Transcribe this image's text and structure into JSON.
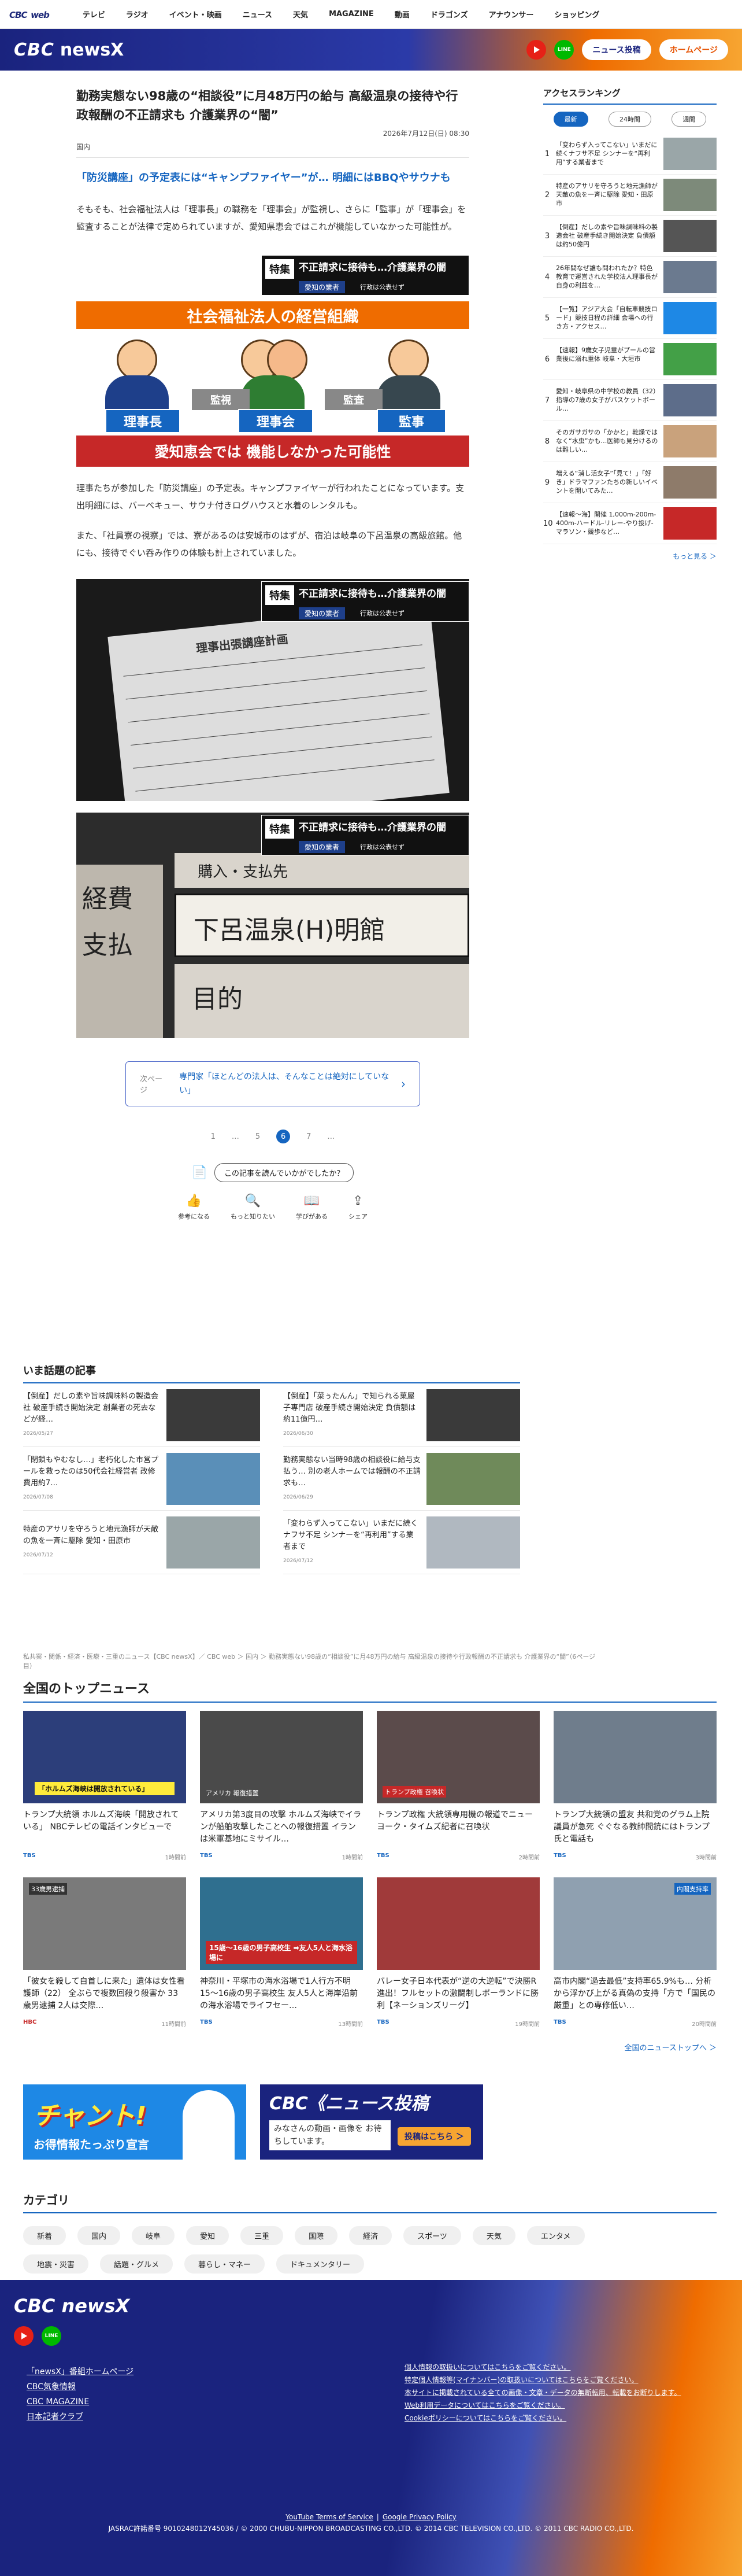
{
  "topnav": {
    "logo": "CBC",
    "logo_sub": "web",
    "items": [
      "テレビ",
      "ラジオ",
      "イベント・映画",
      "ニュース",
      "天気",
      "MAGAZINE",
      "動画",
      "ドラゴンズ",
      "アナウンサー",
      "ショッピング"
    ]
  },
  "banner": {
    "brand": "CBC",
    "brand2": "newsX",
    "post_btn": "ニュース投稿",
    "home_btn": "ホームページ"
  },
  "article": {
    "title": "勤務実態ない98歳の“相談役”に月48万円の給与 高級温泉の接待や行政報酬の不正請求も 介護業界の“闇”",
    "date": "2026年7月12日(日) 08:30",
    "category": "国内",
    "lead": "「防災講座」の予定表には“キャンプファイヤー”が… 明細にはBBQやサウナも",
    "p1": "そもそも、社会福祉法人は「理事長」の職務を「理事会」が監視し、さらに「監事」が「理事会」を監査することが法律で定められていますが、愛知県恵会ではこれが機能していなかった可能性が。",
    "p2": "理事たちが参加した「防災講座」の予定表。キャンプファイヤーが行われたことになっています。支出明細には、バーベキュー、サウナ付きログハウスと水着のレンタルも。",
    "p3": "また、「社員寮の視察」では、寮があるのは安城市のはずが、宿泊は岐阜の下呂温泉の高級旅館。他にも、接待でぐい呑み作りの体験も計上されていました。",
    "badge": {
      "tokushu": "特集",
      "headline": "不正請求に接待も…介護業界の闇",
      "tag": "愛知の業者",
      "sub": "行政は公表せず"
    },
    "fig1": {
      "heading": "社会福祉法人の経営組織",
      "role1": "理事長",
      "role2": "理事会",
      "role3": "監事",
      "arrow1": "監視",
      "arrow2": "監査",
      "bottom": "愛知恵会では 機能しなかった可能性"
    },
    "fig2": {
      "doc_title": "理事出張講座計画"
    },
    "fig3": {
      "col": "購入・支払先",
      "row1": "下呂温泉(H)明館",
      "row2": "目的",
      "left1": "経費",
      "left2": "支払"
    }
  },
  "related": {
    "page": "次ページ",
    "text": "専門家「ほとんどの法人は、そんなことは絶対にしていない」"
  },
  "pager": [
    "1",
    "…",
    "5",
    "6",
    "7",
    "…"
  ],
  "pager_current": "6",
  "read": {
    "question": "この記事を読んでいかがでしたか？"
  },
  "reactions": [
    "参考になる",
    "もっと知りたい",
    "学びがある",
    "シェア"
  ],
  "ranking": {
    "title": "アクセスランキング",
    "tabs": [
      "最新",
      "24時間",
      "週間"
    ],
    "items": [
      {
        "n": "1",
        "text": "「変わらず入ってこない」いまだに続くナフサ不足 シンナーを“再利用”する業者まで"
      },
      {
        "n": "2",
        "text": "特産のアサリを守ろうと地元漁師が天敵の魚を一斉に駆除 愛知・田原市"
      },
      {
        "n": "3",
        "text": "【倒産】だしの素や旨味調味料の製造会社 破産手続き開始決定 負債額は約50億円"
      },
      {
        "n": "4",
        "text": "26年間なぜ誰も問われたか？特色教育で運営された学校法人理事長が自身の利益を…"
      },
      {
        "n": "5",
        "text": "【一覧】アジア大会「自転車競技ロード」競技日程の詳細 会場への行き方・アクセス…"
      },
      {
        "n": "6",
        "text": "【速報】9歳女子児童がプールの営業後に溺れ重体 岐阜・大垣市"
      },
      {
        "n": "7",
        "text": "愛知・岐阜県の中学校の教員（32）指導の7歳の女子がバスケットボール…"
      },
      {
        "n": "8",
        "text": "そのガサガサの「かかと」乾燥ではなく“水虫”かも…医師も見分けるのは難しい…"
      },
      {
        "n": "9",
        "text": "増える“消し活女子”「見て！」「好き」ドラマファンたちの新しいイベントを開いてみた…"
      },
      {
        "n": "10",
        "text": "【速報～海】開催 1,000m-200m-400m-ハードル-リレー-やり投げ-マラソン・競歩など…"
      }
    ],
    "more": "もっと見る ＞"
  },
  "hot": {
    "title": "いま話題の記事",
    "items": [
      {
        "text": "【倒産】だしの素や旨味調味料の製造会社 破産手続き開始決定 創業者の死去などが経…",
        "date": "2026/05/27"
      },
      {
        "text": "【倒産】「菜ぅたんん」で知られる菓屋子専門店 破産手続き開始決定 負債額は約11億円…",
        "date": "2026/06/30"
      },
      {
        "text": "「閉鎖もやむなし…」老朽化した市営プールを救ったのは50代会社経営者 改修費用約7…",
        "date": "2026/07/08"
      },
      {
        "text": "勤務実態ない当時98歳の相談役に給与支払う… 別の老人ホームでは報酬の不正請求も…",
        "date": "2026/06/29"
      },
      {
        "text": "特産のアサリを守ろうと地元漁師が天敵の魚を一斉に駆除 愛知・田原市",
        "date": "2026/07/12"
      },
      {
        "text": "「変わらず入ってこない」いまだに続くナフサ不足 シンナーを“再利用”する業者まで",
        "date": "2026/07/12"
      }
    ]
  },
  "breadcrumb": "私共案・関係・経済・医療・三重のニュース【CBC newsX】／ CBC web ＞ 国内 ＞ 勤務実態ない98歳の“相談役”に月48万円の給与 高級温泉の接待や行政報酬の不正請求も 介護業界の“闇”（6ページ目）",
  "topnews": {
    "title": "全国のトップニュース",
    "more": "全国のニューストップへ ＞",
    "items": [
      {
        "text": "トランプ大統領 ホルムズ海峡「開放されている」 NBCテレビの電話インタビューで",
        "src": "TBS",
        "date": "1時間前",
        "cap": "「ホルムズ海峡は開放されている」"
      },
      {
        "text": "アメリカ第3度目の攻撃 ホルムズ海峡でイランが船舶攻撃したことへの報復措置 イランは米軍基地にミサイル…",
        "src": "TBS",
        "date": "1時間前",
        "cap": "アメリカ 報復措置"
      },
      {
        "text": "トランプ政権 大統領専用機の報道でニューヨーク・タイムズ紀者に召喚状",
        "src": "TBS",
        "date": "2時間前",
        "cap": "トランプ政権 召喚状"
      },
      {
        "text": "トランプ大統領の盟友 共和党のグラム上院議員が急死 ぐぐなる教帥間銃にはトランプ氏と電話も",
        "src": "TBS",
        "date": "3時間前",
        "cap": ""
      },
      {
        "text": "「彼女を殺して自首しに来た」遺体は女性看護師（22） 全ぶらで複数回殺り殺害か 33歳男逮捕 2人は交際…",
        "src": "HBC",
        "date": "11時間前",
        "cap": "33歳男逮捕"
      },
      {
        "text": "神奈川・平塚市の海水浴場で1人行方不明 15～16歳の男子高校生 友人5人と海岸沿前の海水浴場でライフセー…",
        "src": "TBS",
        "date": "13時間前",
        "cap": "15歳～16歳の男子高校生 ➡友人5人と海水浴場に"
      },
      {
        "text": "バレー女子日本代表が“逆の大逆転”で決勝R進出！フルセットの激闘制しポーランドに勝利【ネーションズリーグ】",
        "src": "TBS",
        "date": "19時間前",
        "cap": ""
      },
      {
        "text": "高市内閣“過去最低”支持率65.9%も… 分析から浮かび上がる真偽の支持「方で「国民の厳重」との専修低い…",
        "src": "TBS",
        "date": "20時間前",
        "cap": "内閣支持率"
      }
    ]
  },
  "ads": {
    "a1_big": "チャント!",
    "a1_sub": "お得情報たっぷり宣言",
    "a2_head": "CBC《ニュース投稿",
    "a2_body": "みなさんの動画・画像を お待ちしています。",
    "a2_btn": "投稿はこちら ＞"
  },
  "categories": {
    "title": "カテゴリ",
    "items": [
      "新着",
      "国内",
      "岐阜",
      "愛知",
      "三重",
      "国際",
      "経済",
      "スポーツ",
      "天気",
      "エンタメ",
      "地震・災害",
      "話題・グルメ",
      "暮らし・マネー",
      "ドキュメンタリー"
    ]
  },
  "footer": {
    "brand": "CBC newsX",
    "links": [
      "「newsX」番組ホームページ",
      "CBC気象情報",
      "CBC MAGAZINE",
      "日本記者クラブ"
    ],
    "policy": [
      "個人情報の取扱いについてはこちらをご覧ください。",
      "特定個人情報等(マイナンバー)の取扱いについてはこちらをご覧ください。",
      "本サイトに掲載されている全ての画像・文章・データの無断転用、転載をお断りします。",
      "Web利用データについてはこちらをご覧ください。",
      "Cookieポリシーについてはこちらをご覧ください。"
    ],
    "yt": "YouTube Terms of Service",
    "gp": "Google Privacy Policy",
    "copy": "JASRAC許諾番号 9010248012Y45036 / © 2000 CHUBU-NIPPON BROADCASTING CO.,LTD. © 2014 CBC TELEVISION CO.,LTD. © 2011 CBC RADIO CO.,LTD."
  },
  "colors": {
    "brand_navy": "#1a237e",
    "accent_orange": "#ef6c00",
    "link_blue": "#1565c0"
  }
}
